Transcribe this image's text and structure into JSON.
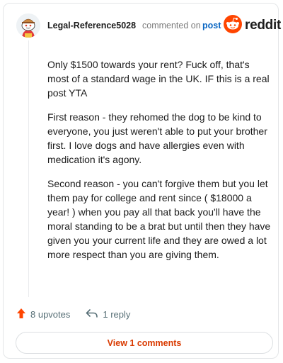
{
  "comment": {
    "username": "Legal-Reference5028",
    "action_text": "commented on",
    "post_link_text": "post",
    "paragraphs": [
      "Only $1500 towards your rent? Fuck off, that's most of a standard wage in the UK. IF this is a real post YTA",
      "First reason - they rehomed the dog to be kind to everyone, you just weren't able to put your brother first. I love dogs and have allergies even with medication it's agony.",
      "Second reason - you can't forgive them but you let them pay for college and rent since ( $18000 a year! ) when you pay all that back you'll have the moral standing to be a brat but until then they have given you your current life and they are owed a lot more respect than you are giving them."
    ]
  },
  "brand": {
    "wordmark": "reddit",
    "color": "#ff4500"
  },
  "footer": {
    "upvotes_label": "8 upvotes",
    "replies_label": "1 reply",
    "upvote_color": "#ff4500"
  },
  "view_comments_label": "View 1 comments",
  "icons": {
    "avatar": "snoo-avatar",
    "upvote": "arrow-up-icon",
    "reply": "reply-arrow-icon",
    "brand": "reddit-snoo-icon"
  }
}
